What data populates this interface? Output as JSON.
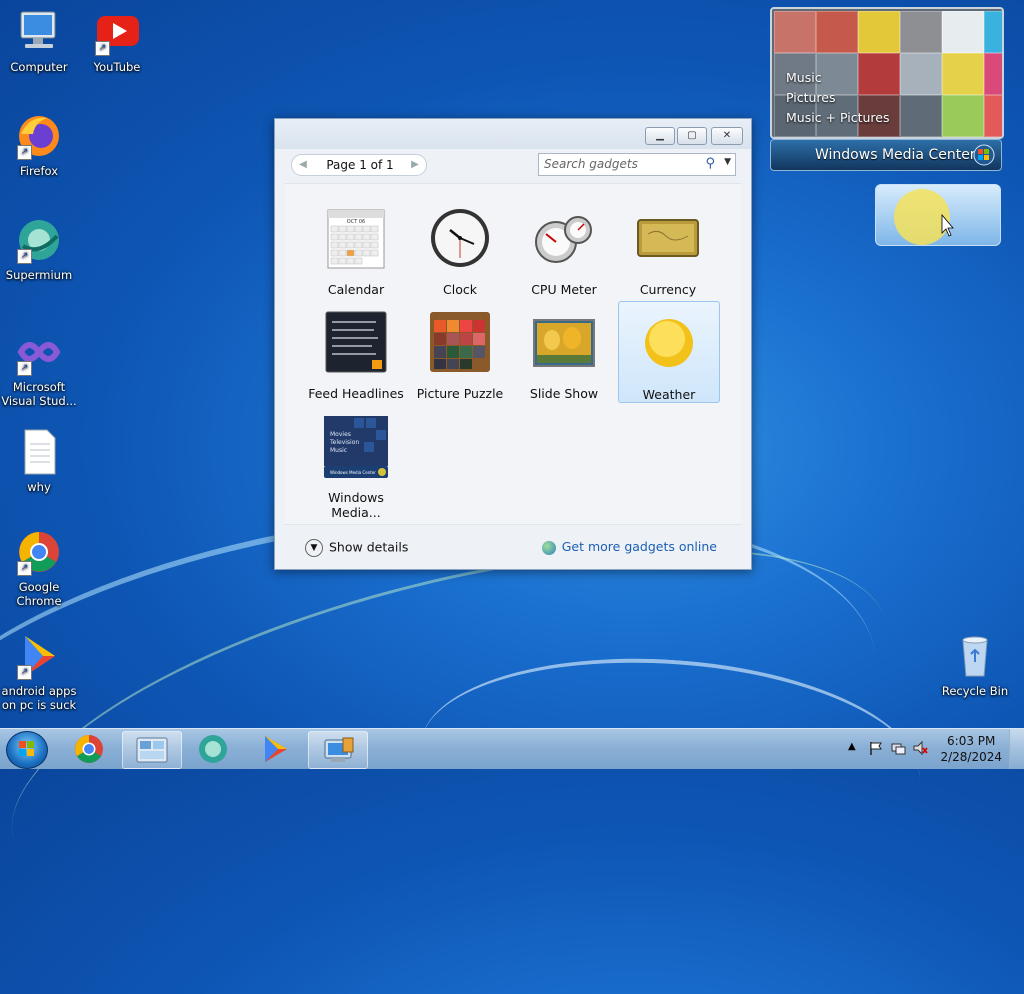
{
  "desktop_icons": [
    {
      "label": "Computer",
      "icon": "computer-icon"
    },
    {
      "label": "YouTube",
      "icon": "youtube-icon"
    },
    {
      "label": "Firefox",
      "icon": "firefox-icon"
    },
    {
      "label": "Supermium",
      "icon": "supermium-icon"
    },
    {
      "label": "Microsoft Visual Stud...",
      "icon": "visual-studio-icon"
    },
    {
      "label": "why",
      "icon": "text-file-icon"
    },
    {
      "label": "Google Chrome",
      "icon": "chrome-icon"
    },
    {
      "label": "android apps on pc is suck",
      "icon": "play-store-icon"
    },
    {
      "label": "Recycle Bin",
      "icon": "recycle-bin-icon"
    }
  ],
  "media_center_gadget": {
    "menu": [
      "Music",
      "Pictures",
      "Music + Pictures"
    ],
    "brand": "Windows Media Center"
  },
  "gadget_window": {
    "pager": "Page 1 of 1",
    "search_placeholder": "Search gadgets",
    "gadgets": [
      {
        "label": "Calendar",
        "selected": false
      },
      {
        "label": "Clock",
        "selected": false
      },
      {
        "label": "CPU Meter",
        "selected": false
      },
      {
        "label": "Currency",
        "selected": false
      },
      {
        "label": "Feed Headlines",
        "selected": false
      },
      {
        "label": "Picture Puzzle",
        "selected": false
      },
      {
        "label": "Slide Show",
        "selected": false
      },
      {
        "label": "Weather",
        "selected": true
      },
      {
        "label": "Windows Media...",
        "selected": false
      }
    ],
    "calendar_thumb_month": "OCT 06",
    "wmc_thumb_lines": [
      "Movies",
      "Television",
      "Music"
    ],
    "wmc_thumb_brand": "Windows Media Center",
    "show_details": "Show details",
    "get_more": "Get more gadgets online"
  },
  "taskbar": {
    "time": "6:03 PM",
    "date": "2/28/2024",
    "pinned": [
      "chrome-icon",
      "gadgets-icon",
      "supermium-icon",
      "play-store-icon",
      "control-panel-icon"
    ]
  },
  "colors": {
    "desktop_blue": "#1a6fcf",
    "selection_blue": "#cfe6fb",
    "link_blue": "#1b5eb3"
  }
}
